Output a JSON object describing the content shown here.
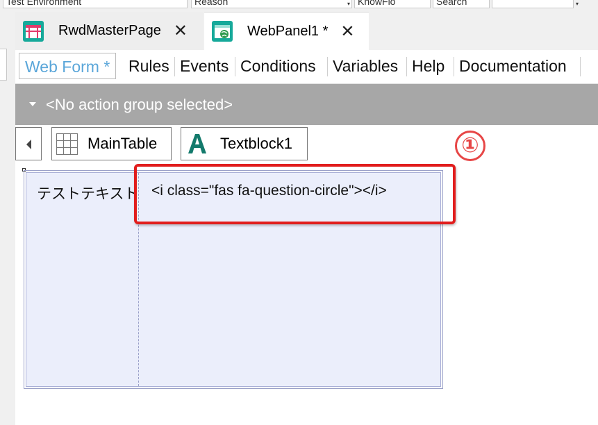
{
  "topbar": {
    "field1": "Test Environment",
    "field2": "Reason",
    "field3": "KnowFlo",
    "field4": "Search"
  },
  "doc_tabs": [
    {
      "label": "RwdMasterPage",
      "icon": "master-page-icon",
      "close": "✕"
    },
    {
      "label": "WebPanel1 *",
      "icon": "web-panel-icon",
      "close": "✕"
    }
  ],
  "sub_tabs": [
    {
      "label": "Web Form *",
      "active": true
    },
    {
      "label": "Rules"
    },
    {
      "label": "Events"
    },
    {
      "label": "Conditions"
    },
    {
      "label": "Variables"
    },
    {
      "label": "Help"
    },
    {
      "label": "Documentation"
    }
  ],
  "action_bar": {
    "text": "<No action group selected>"
  },
  "breadcrumb": {
    "items": [
      {
        "label": "MainTable",
        "icon": "table-grid-icon"
      },
      {
        "label": "Textblock1",
        "icon": "textblock-a-icon"
      }
    ]
  },
  "annotation": {
    "number": "①",
    "color": "#e74646"
  },
  "form": {
    "label_cell": "テストテキスト",
    "code_cell": "<i class=\"fas fa-question-circle\"></i>"
  },
  "colors": {
    "active_tab_text": "#5aa6d9",
    "action_bar_bg": "#a7a7a7",
    "table_bg": "#ebeefb",
    "highlight": "#e11d1d"
  }
}
